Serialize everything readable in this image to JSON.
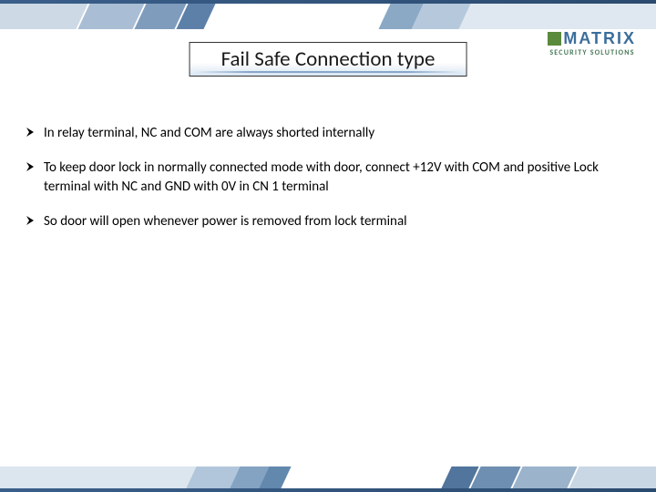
{
  "title": "Fail Safe Connection type",
  "logo": {
    "brand": "MATRIX",
    "tagline": "SECURITY SOLUTIONS"
  },
  "bullets": [
    "In relay terminal, NC and COM are always shorted internally",
    "To keep door lock in normally connected mode with door, connect +12V with COM and positive Lock terminal with NC and GND with 0V in CN 1 terminal",
    "So door will open whenever power is removed from lock terminal"
  ],
  "decor": {
    "top_colors": [
      "#cdd9e5",
      "#a9bed4",
      "#7f9cbd",
      "#5d80a8",
      "#dfe8f0"
    ],
    "bottom_colors": [
      "#c9d7e4",
      "#9bb4cc",
      "#6e8fb2",
      "#51759c",
      "#dce6ef"
    ]
  }
}
